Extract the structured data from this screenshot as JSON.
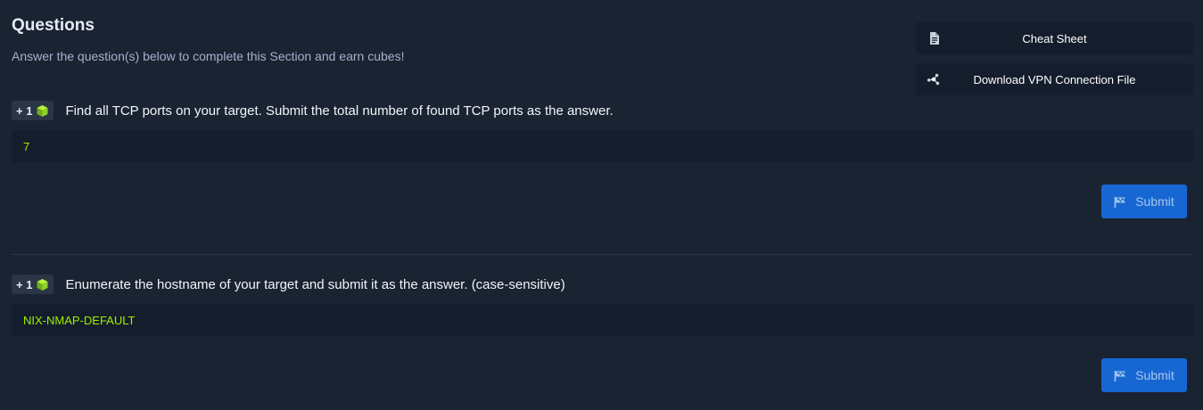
{
  "header": {
    "title": "Questions",
    "subtitle": "Answer the question(s) below to complete this Section and earn cubes!"
  },
  "sidebar_buttons": {
    "cheat_sheet": {
      "label": "Cheat Sheet",
      "icon": "document-icon"
    },
    "vpn": {
      "label": "Download VPN Connection File",
      "icon": "network-icon"
    }
  },
  "questions": [
    {
      "badge": "+ 1",
      "badge_icon": "cube-icon",
      "text": "Find all TCP ports on your target. Submit the total number of found TCP ports as the answer.",
      "answer": "7",
      "submit_label": "Submit"
    },
    {
      "badge": "+ 1",
      "badge_icon": "cube-icon",
      "text": "Enumerate the hostname of your target and submit it as the answer. (case-sensitive)",
      "answer": "NIX-NMAP-DEFAULT",
      "submit_label": "Submit"
    }
  ],
  "colors": {
    "background": "#1a2332",
    "panel": "#141d2b",
    "answer_text": "#9fef00",
    "submit_button": "#1667d1"
  }
}
